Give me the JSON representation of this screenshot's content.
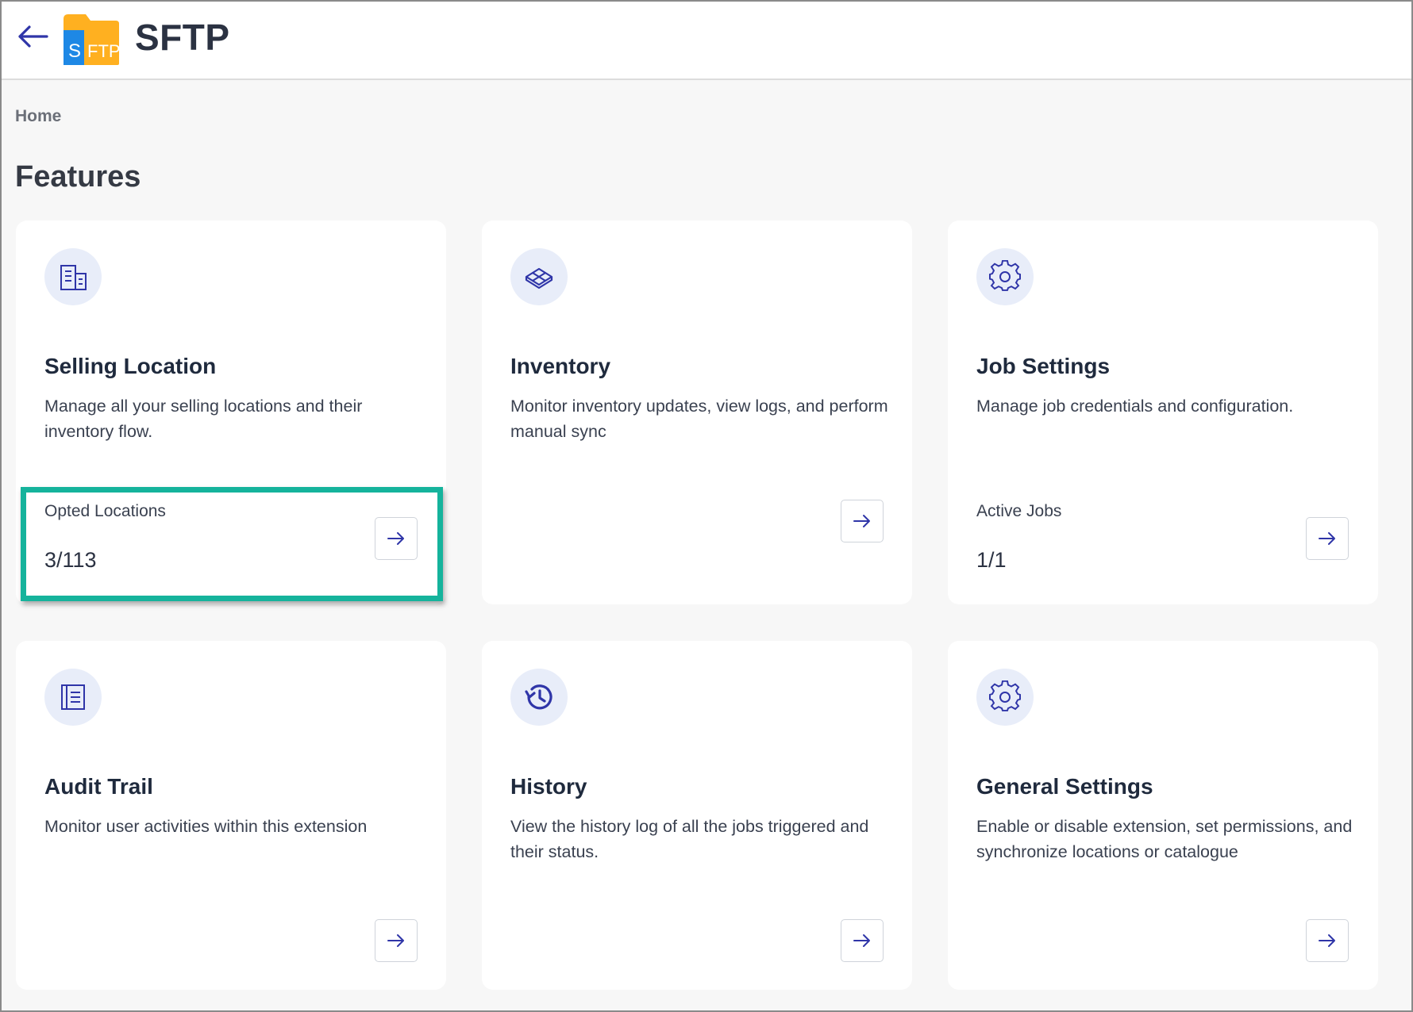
{
  "header": {
    "back_icon": "arrow-left-icon",
    "logo_icon": "sftp-folder-logo",
    "logo_letters": {
      "s": "S",
      "ftp": "FTP"
    },
    "title": "SFTP"
  },
  "breadcrumb": "Home",
  "page_title": "Features",
  "colors": {
    "accent": "#2f35a8",
    "highlight": "#15b39c",
    "icon_bg": "#e8edf9",
    "logo_orange": "#ffb020",
    "logo_blue": "#1e88e5"
  },
  "cards": [
    {
      "icon": "building-icon",
      "title": "Selling Location",
      "description": "Manage all your selling locations and their inventory flow.",
      "stat_label": "Opted Locations",
      "stat_value": "3/113",
      "action_icon": "arrow-right-icon"
    },
    {
      "icon": "cube-icon",
      "title": "Inventory",
      "description": "Monitor inventory updates, view logs, and perform manual sync",
      "action_icon": "arrow-right-icon"
    },
    {
      "icon": "gear-icon",
      "title": "Job Settings",
      "description": "Manage job credentials and configuration.",
      "stat_label": "Active Jobs",
      "stat_value": "1/1",
      "action_icon": "arrow-right-icon"
    },
    {
      "icon": "notebook-icon",
      "title": "Audit Trail",
      "description": "Monitor user activities within this extension",
      "action_icon": "arrow-right-icon"
    },
    {
      "icon": "history-icon",
      "title": "History",
      "description": "View the history log of all the jobs triggered and their status.",
      "action_icon": "arrow-right-icon"
    },
    {
      "icon": "gear-icon",
      "title": "General Settings",
      "description": "Enable or disable extension, set permissions, and synchronize locations or catalogue",
      "action_icon": "arrow-right-icon"
    }
  ]
}
